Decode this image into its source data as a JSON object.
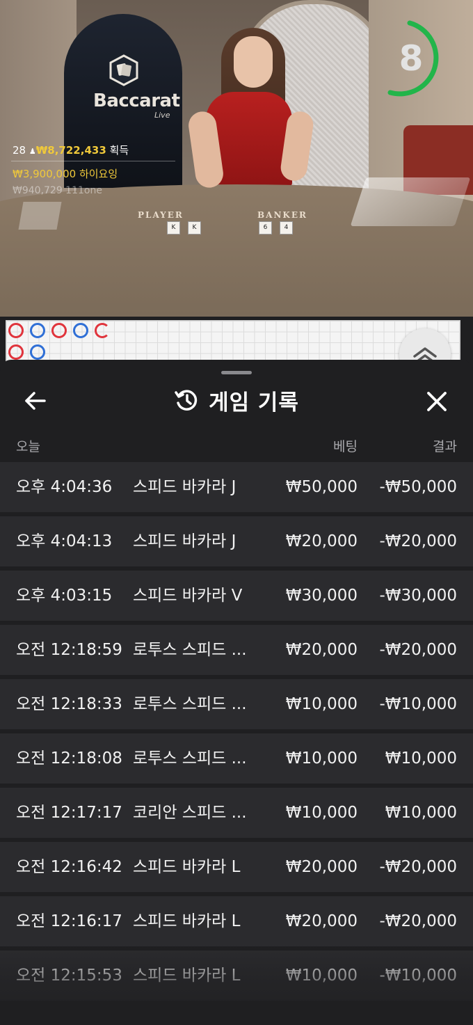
{
  "video": {
    "logo_title": "Baccarat",
    "logo_sub": "Live",
    "player_label": "PLAYER",
    "banker_label": "BANKER",
    "player_cards": [
      "K",
      "K"
    ],
    "banker_cards": [
      "6",
      "4"
    ],
    "timer": "8",
    "win_line": {
      "count": "28",
      "amount": "₩8,722,433",
      "suffix": "획득"
    },
    "winner_line": {
      "amount": "₩3,900,000",
      "name": "하이요잉"
    },
    "winner_line_2": "₩940,729  111one"
  },
  "roadmap": {
    "colors": {
      "banker": "#e0343c",
      "player": "#2f6fd6"
    },
    "row1": [
      "banker",
      "player",
      "banker",
      "player",
      "banker-partial"
    ],
    "row2": [
      "banker",
      "player"
    ]
  },
  "sheet": {
    "title": "게임 기록",
    "icons": {
      "back": "arrow-left-icon",
      "history": "history-icon",
      "close": "close-icon"
    },
    "headers": {
      "date": "오늘",
      "bet": "베팅",
      "result": "결과"
    },
    "rows": [
      {
        "time": "오후 4:04:36",
        "game": "스피드 바카라 J",
        "bet": "₩50,000",
        "result": "-₩50,000"
      },
      {
        "time": "오후 4:04:13",
        "game": "스피드 바카라 J",
        "bet": "₩20,000",
        "result": "-₩20,000"
      },
      {
        "time": "오후 4:03:15",
        "game": "스피드 바카라 V",
        "bet": "₩30,000",
        "result": "-₩30,000"
      },
      {
        "time": "오전 12:18:59",
        "game": "로투스 스피드 ...",
        "bet": "₩20,000",
        "result": "-₩20,000"
      },
      {
        "time": "오전 12:18:33",
        "game": "로투스 스피드 ...",
        "bet": "₩10,000",
        "result": "-₩10,000"
      },
      {
        "time": "오전 12:18:08",
        "game": "로투스 스피드 ...",
        "bet": "₩10,000",
        "result": "₩10,000"
      },
      {
        "time": "오전 12:17:17",
        "game": "코리안 스피드 ...",
        "bet": "₩10,000",
        "result": "₩10,000"
      },
      {
        "time": "오전 12:16:42",
        "game": "스피드 바카라 L",
        "bet": "₩20,000",
        "result": "-₩20,000"
      },
      {
        "time": "오전 12:16:17",
        "game": "스피드 바카라 L",
        "bet": "₩20,000",
        "result": "-₩20,000"
      },
      {
        "time": "오전 12:15:53",
        "game": "스피드 바카라 L",
        "bet": "₩10,000",
        "result": "-₩10,000"
      }
    ]
  }
}
